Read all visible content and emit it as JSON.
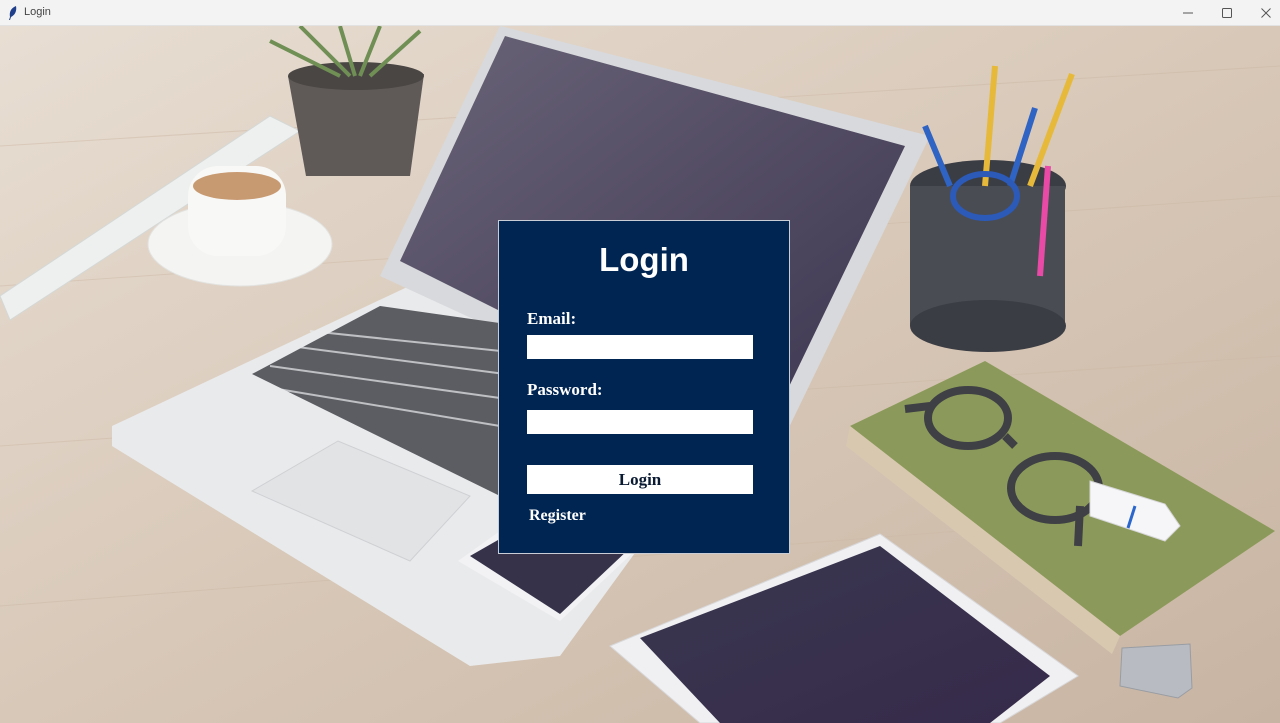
{
  "window": {
    "title": "Login",
    "app_icon": "feather-icon",
    "controls": [
      "minimize-icon",
      "maximize-icon",
      "close-icon"
    ]
  },
  "background": {
    "description_icon": "desk-workspace-photo"
  },
  "login_form": {
    "title": "Login",
    "email_label": "Email:",
    "email_value": "",
    "password_label": "Password:",
    "password_value": "",
    "login_button": "Login",
    "register_link": "Register",
    "panel_color": "#012552"
  }
}
